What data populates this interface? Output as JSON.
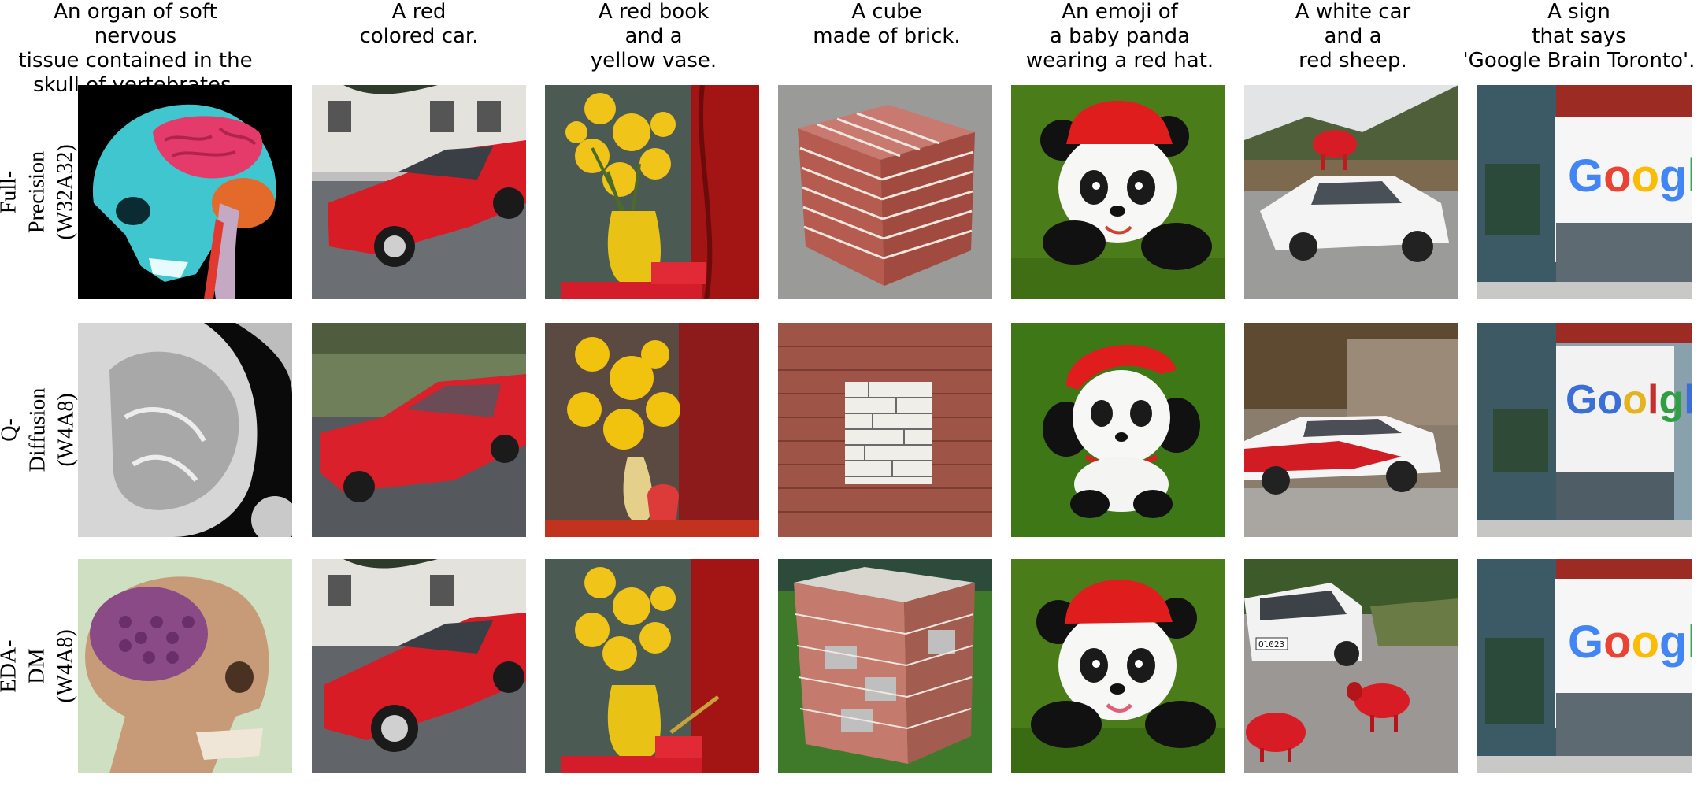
{
  "captions": [
    "An organ of soft nervous\ntissue contained in the\nskull of vertebrates.",
    "A red\ncolored car.",
    "A red book\nand a\nyellow vase.",
    "A cube\nmade of brick.",
    "An emoji of\na baby panda\nwearing a red hat.",
    "A white car\nand a\nred sheep.",
    "A sign\nthat says\n'Google Brain Toronto'."
  ],
  "rows": [
    {
      "label": "Full-Precision\n(W32A32)"
    },
    {
      "label": "Q-Diffusion\n(W4A8)"
    },
    {
      "label": "EDA-DM\n(W4A8)"
    }
  ],
  "sign_text": {
    "full": "Google",
    "qdiff": "Goolgl",
    "edadm": "Google"
  },
  "plate_text": "Ol023",
  "colors": {
    "red": "#e11b22",
    "panda_bg": "#4a7d1a",
    "brick": "#b55b4f",
    "google_blue": "#4285f4",
    "google_red": "#ea4335",
    "google_yellow": "#fbbc05",
    "google_green": "#34a853"
  }
}
